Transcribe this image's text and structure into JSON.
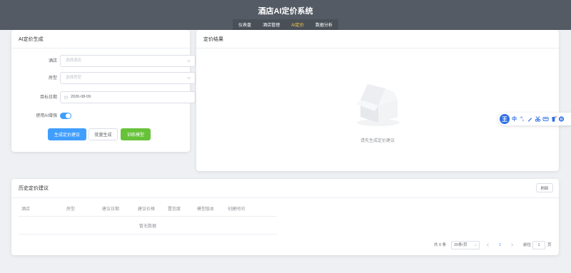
{
  "header": {
    "title": "酒店AI定价系统",
    "nav": [
      "仪表盘",
      "酒店管理",
      "AI定价",
      "数据分析"
    ],
    "active_nav": "AI定价"
  },
  "form_card": {
    "title": "AI定价生成",
    "hotel_label": "酒店",
    "hotel_placeholder": "选择酒店",
    "room_label": "房型",
    "room_placeholder": "选择房型",
    "date_label": "目标日期",
    "date_value": "2026-08-09",
    "ai_label": "使用AI增强",
    "ai_enabled": true,
    "buttons": {
      "generate": "生成定价建议",
      "batch": "批量生成",
      "train": "训练模型"
    }
  },
  "result_card": {
    "title": "定价结果",
    "empty_text": "请先生成定价建议"
  },
  "history": {
    "title": "历史定价建议",
    "refresh": "刷新",
    "columns": [
      "酒店",
      "房型",
      "建议日期",
      "建议价格",
      "置信度",
      "模型版本",
      "创建时间"
    ],
    "empty_text": "暂无数据",
    "pagination": {
      "total": "共 0 条",
      "page_size": "20条/页",
      "current_page": "1",
      "goto_label": "前往",
      "goto_value": "1",
      "page_suffix": "页"
    }
  },
  "ime_toolbar": {
    "logo": "王",
    "lang": "中",
    "punct": "°,"
  },
  "colors": {
    "primary": "#409eff",
    "success": "#67c23a",
    "header_bg": "#545b64",
    "active_nav": "#ffd04b"
  }
}
